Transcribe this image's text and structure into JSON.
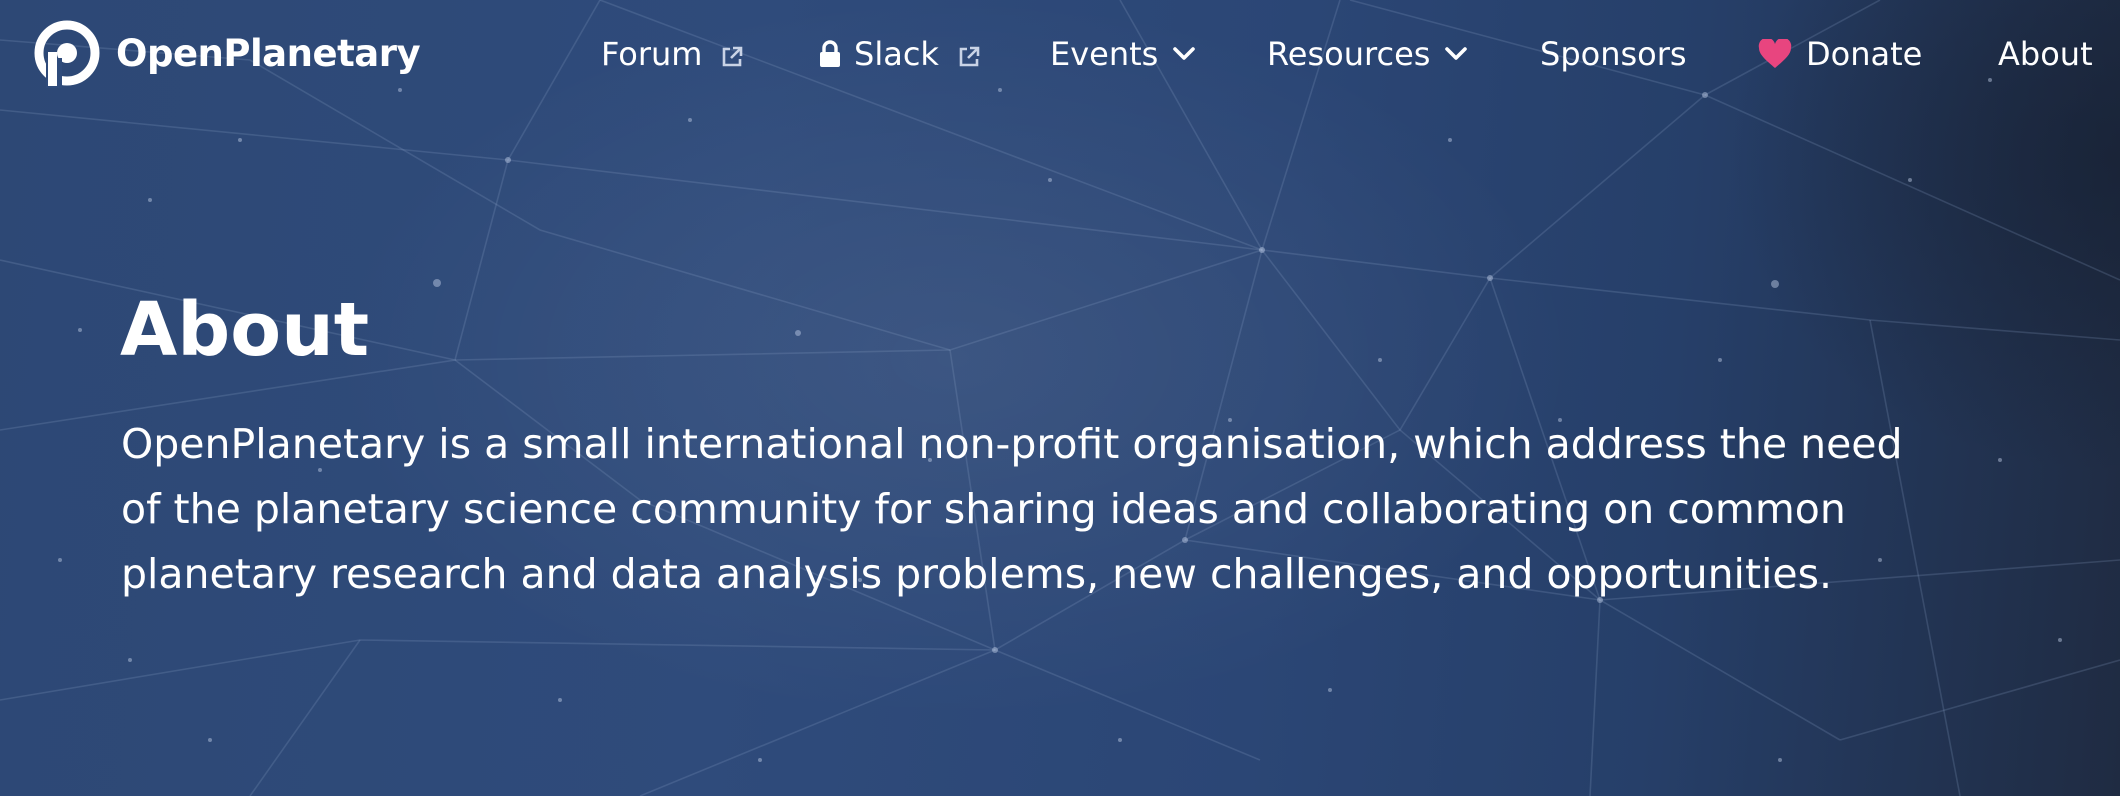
{
  "brand": {
    "name": "OpenPlanetary",
    "logo_icon": "openplanetary-logo-icon"
  },
  "nav": {
    "items": [
      {
        "label": "Forum",
        "icon": "external-link-icon"
      },
      {
        "label": "Slack",
        "icon": "lock-icon",
        "trailing_icon": "external-link-icon"
      },
      {
        "label": "Events",
        "icon": "chevron-down-icon"
      },
      {
        "label": "Resources",
        "icon": "chevron-down-icon"
      },
      {
        "label": "Sponsors"
      },
      {
        "label": "Donate",
        "icon": "heart-icon"
      },
      {
        "label": "About"
      }
    ]
  },
  "main": {
    "title": "About",
    "intro_lines": [
      "OpenPlanetary is a small international non-profit organisation, which address the need",
      "of the planetary science community for sharing ideas and collaborating on common",
      "planetary research and data analysis problems, new challenges, and opportunities."
    ]
  },
  "colors": {
    "background": "#2f4b7b",
    "text": "#ffffff",
    "heart": "#e8457f",
    "network_lines": "#8fa3c8"
  }
}
